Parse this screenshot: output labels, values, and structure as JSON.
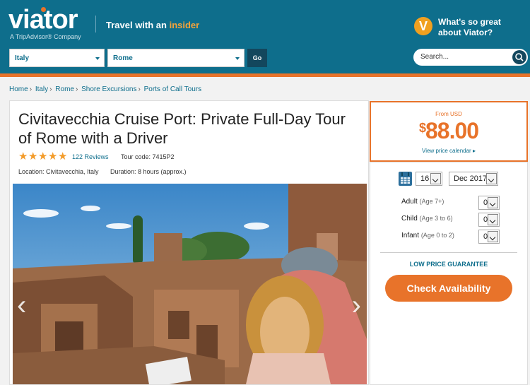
{
  "header": {
    "logo": "viator",
    "logo_sub": "A TripAdvisor® Company",
    "tagline_prefix": "Travel with an ",
    "tagline_accent": "insider",
    "badge": "V",
    "whats_line1": "What's so great",
    "whats_line2": "about Viator?",
    "country_select": "Italy",
    "city_select": "Rome",
    "go_label": "Go",
    "search_placeholder": "Search..."
  },
  "breadcrumb": [
    "Home",
    "Italy",
    "Rome",
    "Shore Excursions",
    "Ports of Call Tours"
  ],
  "product": {
    "title": "Civitavecchia Cruise Port: Private Full-Day Tour of Rome with a Driver",
    "rating": 5,
    "reviews": "122 Reviews",
    "tour_code": "Tour code: 7415P2",
    "location": "Location: Civitavecchia, Italy",
    "duration": "Duration: 8 hours (approx.)",
    "prev_arrow": "‹",
    "next_arrow": "›"
  },
  "price": {
    "from": "From USD",
    "currency": "$",
    "amount": "88.00",
    "calendar_link": "View price calendar"
  },
  "booking": {
    "day": "16",
    "month": "Dec 2017",
    "adult_label": "Adult",
    "adult_age": "(Age 7+)",
    "adult_count": "0",
    "child_label": "Child",
    "child_age": "(Age 3 to 6)",
    "child_count": "0",
    "infant_label": "Infant",
    "infant_age": "(Age 0 to 2)",
    "infant_count": "0",
    "guarantee": "LOW PRICE GUARANTEE",
    "check_button": "Check Availability"
  },
  "colors": {
    "header_blue": "#0e6e8c",
    "accent_orange": "#e8732a",
    "dark_navy": "#13475d"
  }
}
